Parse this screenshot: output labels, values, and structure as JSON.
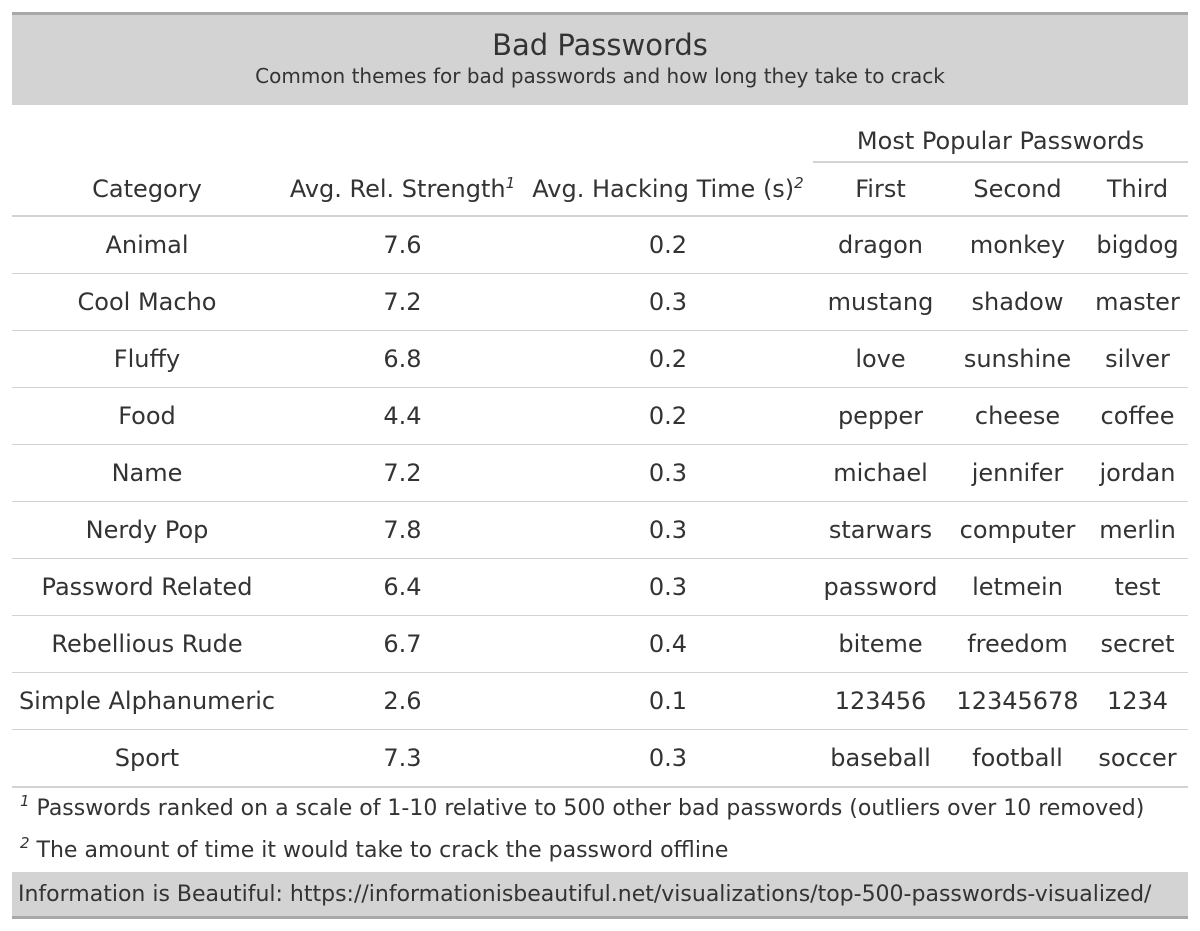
{
  "title": "Bad Passwords",
  "subtitle": "Common themes for bad passwords and how long they take to crack",
  "spanner": "Most Popular Passwords",
  "columns": {
    "category": "Category",
    "strength": "Avg. Rel. Strength",
    "strength_mark": "1",
    "time": "Avg. Hacking Time (s)",
    "time_mark": "2",
    "first": "First",
    "second": "Second",
    "third": "Third"
  },
  "rows": [
    {
      "category": "Animal",
      "strength": "7.6",
      "time": "0.2",
      "first": "dragon",
      "second": "monkey",
      "third": "bigdog"
    },
    {
      "category": "Cool Macho",
      "strength": "7.2",
      "time": "0.3",
      "first": "mustang",
      "second": "shadow",
      "third": "master"
    },
    {
      "category": "Fluffy",
      "strength": "6.8",
      "time": "0.2",
      "first": "love",
      "second": "sunshine",
      "third": "silver"
    },
    {
      "category": "Food",
      "strength": "4.4",
      "time": "0.2",
      "first": "pepper",
      "second": "cheese",
      "third": "coffee"
    },
    {
      "category": "Name",
      "strength": "7.2",
      "time": "0.3",
      "first": "michael",
      "second": "jennifer",
      "third": "jordan"
    },
    {
      "category": "Nerdy Pop",
      "strength": "7.8",
      "time": "0.3",
      "first": "starwars",
      "second": "computer",
      "third": "merlin"
    },
    {
      "category": "Password Related",
      "strength": "6.4",
      "time": "0.3",
      "first": "password",
      "second": "letmein",
      "third": "test"
    },
    {
      "category": "Rebellious Rude",
      "strength": "6.7",
      "time": "0.4",
      "first": "biteme",
      "second": "freedom",
      "third": "secret"
    },
    {
      "category": "Simple Alphanumeric",
      "strength": "2.6",
      "time": "0.1",
      "first": "123456",
      "second": "12345678",
      "third": "1234"
    },
    {
      "category": "Sport",
      "strength": "7.3",
      "time": "0.3",
      "first": "baseball",
      "second": "football",
      "third": "soccer"
    }
  ],
  "footnotes": [
    {
      "mark": "1",
      "text": "Passwords ranked on a scale of 1-10 relative to 500 other bad passwords (outliers over 10 removed)"
    },
    {
      "mark": "2",
      "text": "The amount of time it would take to crack the password offline"
    }
  ],
  "source": "Information is Beautiful: https://informationisbeautiful.net/visualizations/top-500-passwords-visualized/"
}
